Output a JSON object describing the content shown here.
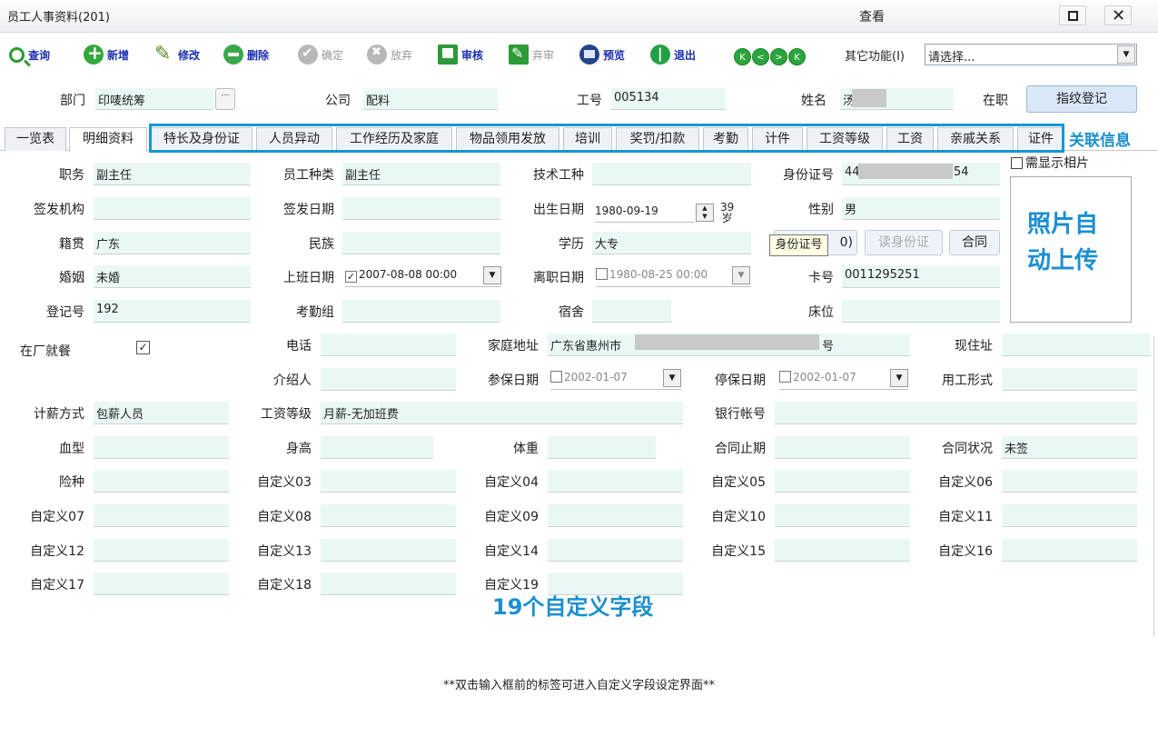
{
  "window": {
    "title": "员工人事资料(201)",
    "mode": "查看",
    "max_icon": "maximize-icon",
    "close_icon": "close-icon",
    "close_glyph": "✕"
  },
  "toolbar": {
    "query": "查询",
    "add": "新增",
    "edit": "修改",
    "delete": "删除",
    "confirm": "确定",
    "abandon": "放弃",
    "audit": "审核",
    "unaudit": "弃审",
    "preview": "预览",
    "exit": "退出",
    "nav": [
      "K",
      "<",
      ">",
      "K"
    ],
    "other_label": "其它功能(I)",
    "other_value": "请选择..."
  },
  "header": {
    "dept_label": "部门",
    "dept_value": "印唛统筹",
    "company_label": "公司",
    "company_value": "配料",
    "emp_no_label": "工号",
    "emp_no_value": "005134",
    "name_label": "姓名",
    "name_value": "汤",
    "status": "在职",
    "fingerprint_button": "指纹登记"
  },
  "tabs": [
    "一览表",
    "明细资料",
    "特长及身份证",
    "人员异动",
    "工作经历及家庭",
    "物品领用发放",
    "培训",
    "奖罚/扣款",
    "考勤",
    "计件",
    "工资等级",
    "工资",
    "亲戚关系",
    "证件"
  ],
  "annotations": {
    "related": "关联信息",
    "photo_line1": "照片自",
    "photo_line2": "动上传",
    "custom": "19个自定义字段"
  },
  "form": {
    "position_label": "职务",
    "position_value": "副主任",
    "emp_type_label": "员工种类",
    "emp_type_value": "副主任",
    "tech_label": "技术工种",
    "tech_value": "",
    "id_label": "身份证号",
    "id_value_start": "44",
    "id_value_end": "54",
    "issuer_label": "签发机构",
    "issuer_value": "",
    "issue_date_label": "签发日期",
    "issue_date_value": "",
    "birth_label": "出生日期",
    "birth_value": "1980-09-19",
    "age_value": "39",
    "age_unit": "岁",
    "gender_label": "性别",
    "gender_value": "男",
    "native_label": "籍贯",
    "native_value": "广东",
    "ethnic_label": "民族",
    "ethnic_value": "",
    "edu_label": "学历",
    "edu_value": "大专",
    "marriage_label": "婚姻",
    "marriage_value": "未婚",
    "start_label": "上班日期",
    "start_value": "2007-08-08 00:00",
    "leave_label": "离职日期",
    "leave_value": "1980-08-25 00:00",
    "card_label": "卡号",
    "card_value": "0011295251",
    "reg_label": "登记号",
    "reg_value": "192",
    "att_group_label": "考勤组",
    "att_group_value": "",
    "dorm_label": "宿舍",
    "dorm_value": "",
    "bed_label": "床位",
    "bed_value": "",
    "meal_label": "在厂就餐",
    "phone_label": "电话",
    "phone_value": "",
    "address_label": "家庭地址",
    "address_value": "广东省惠州市",
    "address_suffix": "号",
    "current_addr_label": "现住址",
    "current_addr_value": "",
    "referrer_label": "介绍人",
    "referrer_value": "",
    "ins_date_label": "参保日期",
    "ins_date_value": "2002-01-07",
    "stop_ins_label": "停保日期",
    "stop_ins_value": "2002-01-07",
    "employ_form_label": "用工形式",
    "employ_form_value": "",
    "salary_method_label": "计薪方式",
    "salary_method_value": "包薪人员",
    "salary_grade_label": "工资等级",
    "salary_grade_value": "月薪-无加班费",
    "bank_label": "银行帐号",
    "bank_value": "",
    "blood_label": "血型",
    "blood_value": "",
    "height_label": "身高",
    "height_value": "",
    "weight_label": "体重",
    "weight_value": "",
    "contract_end_label": "合同止期",
    "contract_end_value": "",
    "contract_status_label": "合同状况",
    "contract_status_value": "未签",
    "insurance_label": "险种",
    "insurance_value": "",
    "custom": [
      "自定义03",
      "自定义04",
      "自定义05",
      "自定义06",
      "自定义07",
      "自定义08",
      "自定义09",
      "自定义10",
      "自定义11",
      "自定义12",
      "自定义13",
      "自定义14",
      "自定义15",
      "自定义16",
      "自定义17",
      "自定义18",
      "自定义19"
    ]
  },
  "buttons": {
    "partial": "0)",
    "read_id": "读身份证",
    "contract": "合同"
  },
  "tooltip": "身份证号",
  "photo": {
    "show_label": "需显示相片"
  },
  "footnote": "**双击输入框前的标签可进入自定义字段设定界面**"
}
